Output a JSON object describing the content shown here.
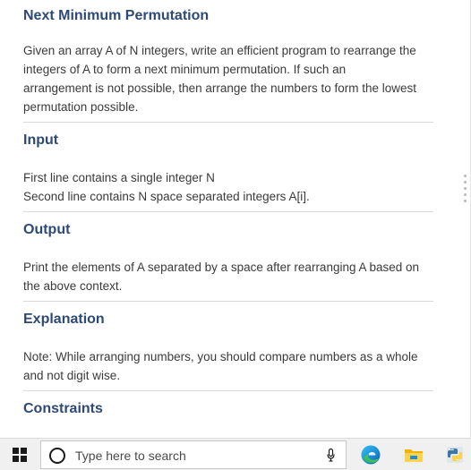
{
  "sections": [
    {
      "title": "Next Minimum Permutation",
      "lines": [
        "Given an array A of N integers, write an efficient program to rearrange the",
        "integers of A to form a next minimum permutation. If such an",
        "arrangement is not possible, then arrange the numbers to form the lowest",
        "permutation possible."
      ]
    },
    {
      "title": "Input",
      "lines": [
        "First line contains a single integer N",
        "Second line contains N space separated integers A[i]."
      ]
    },
    {
      "title": "Output",
      "lines": [
        "Print the elements of A separated by a space after rearranging A based on",
        "the above context."
      ]
    },
    {
      "title": "Explanation",
      "lines": [
        "Note: While arranging numbers, you should compare numbers as a whole",
        "and not digit wise."
      ]
    },
    {
      "title": "Constraints",
      "lines": []
    }
  ],
  "taskbar": {
    "search_placeholder": "Type here to search",
    "icons": [
      "windows-start-icon",
      "search-icon",
      "microphone-icon",
      "edge-icon",
      "file-explorer-icon",
      "python-icon"
    ]
  },
  "colors": {
    "heading": "#2d4a77",
    "body_text": "#3a3a3a",
    "divider": "#d9d9d9",
    "taskbar_bg": "#f0f0f0"
  }
}
